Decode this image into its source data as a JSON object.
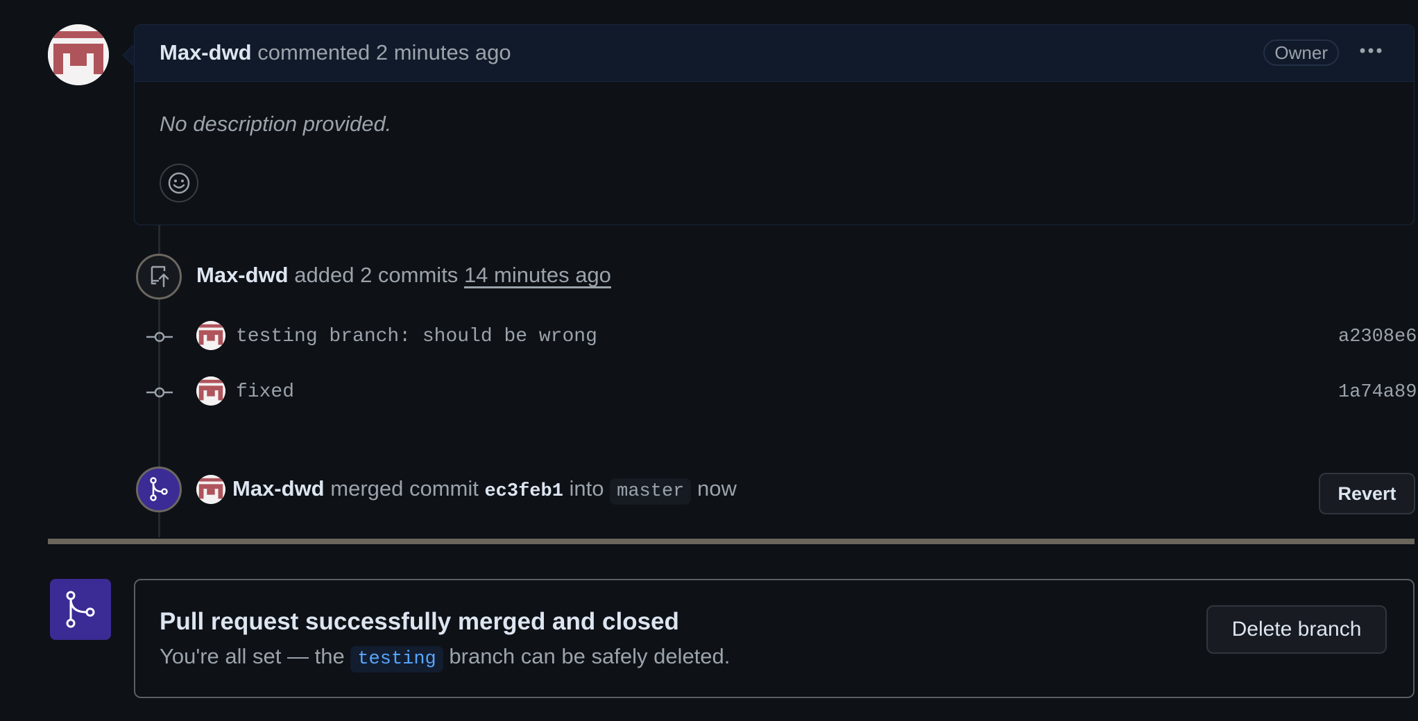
{
  "comment": {
    "author": "Max-dwd",
    "action": "commented",
    "time": "2 minutes ago",
    "badge": "Owner",
    "menu_icon": "kebab-horizontal-icon",
    "body": "No description provided.",
    "reaction_icon": "smiley-icon"
  },
  "commits_event": {
    "author": "Max-dwd",
    "action": "added 2 commits",
    "time": "14 minutes ago",
    "icon": "repo-push-icon",
    "commits": [
      {
        "message": "testing branch: should be wrong",
        "sha": "a2308e6"
      },
      {
        "message": "fixed",
        "sha": "1a74a89"
      }
    ]
  },
  "merge_event": {
    "author": "Max-dwd",
    "action": "merged commit",
    "sha": "ec3feb1",
    "into": "into",
    "branch": "master",
    "time": "now",
    "revert_label": "Revert",
    "icon": "git-merge-icon"
  },
  "merged_box": {
    "title": "Pull request successfully merged and closed",
    "sub_prefix": "You're all set — the",
    "branch": "testing",
    "sub_suffix": "branch can be safely deleted.",
    "delete_label": "Delete branch",
    "icon": "git-merge-icon"
  },
  "colors": {
    "background": "#0e1116",
    "merge_purple": "#3b2b94",
    "avatar_red": "#b0545c",
    "branch_blue": "#58a6ff"
  }
}
